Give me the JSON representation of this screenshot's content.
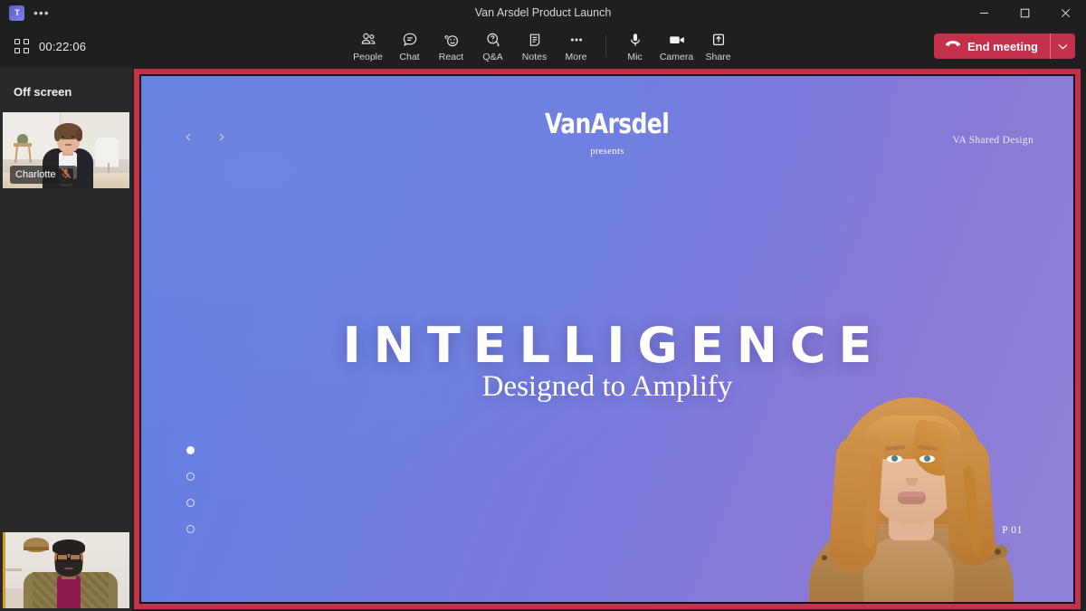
{
  "window": {
    "title": "Van Arsdel Product Launch",
    "app_logo_text": "T",
    "overflow_label": "•••",
    "controls": {
      "minimize": "minimize-button",
      "maximize": "maximize-button",
      "close": "close-button"
    }
  },
  "toolbar": {
    "grid_icon": "grid-view-icon",
    "timer": "00:22:06",
    "items": [
      {
        "label": "People",
        "icon": "people-icon"
      },
      {
        "label": "Chat",
        "icon": "chat-icon"
      },
      {
        "label": "React",
        "icon": "react-icon"
      },
      {
        "label": "Q&A",
        "icon": "qanda-icon"
      },
      {
        "label": "Notes",
        "icon": "notes-icon"
      },
      {
        "label": "More",
        "icon": "more-icon"
      }
    ],
    "controls": [
      {
        "label": "Mic",
        "icon": "microphone-icon"
      },
      {
        "label": "Camera",
        "icon": "camera-icon"
      },
      {
        "label": "Share",
        "icon": "share-icon"
      }
    ],
    "end_meeting": {
      "label": "End meeting",
      "icon": "hangup-icon",
      "caret": "chevron-down-icon",
      "color": "#c4314b"
    }
  },
  "sidebar": {
    "section_label": "Off screen",
    "tiles": [
      {
        "name": "Charlotte",
        "muted": true,
        "mute_icon": "microphone-muted-icon"
      },
      {
        "name": "",
        "muted": false,
        "speaking": true,
        "highlight_color": "#d4a017"
      }
    ]
  },
  "stage": {
    "border_color": "#c4314b",
    "slide": {
      "brand": "VanArsdel",
      "brand_tagline": "presents",
      "watermark": "VA Shared Design",
      "headline": "INTELLIGENCE",
      "subheadline": "Designed to Amplify",
      "page_number": "P 01",
      "prev_arrow": "‹",
      "next_arrow": "›",
      "pagination": {
        "total": 4,
        "active": 1
      },
      "gradient_from": "#5d80e5",
      "gradient_to": "#8f82d6"
    }
  }
}
